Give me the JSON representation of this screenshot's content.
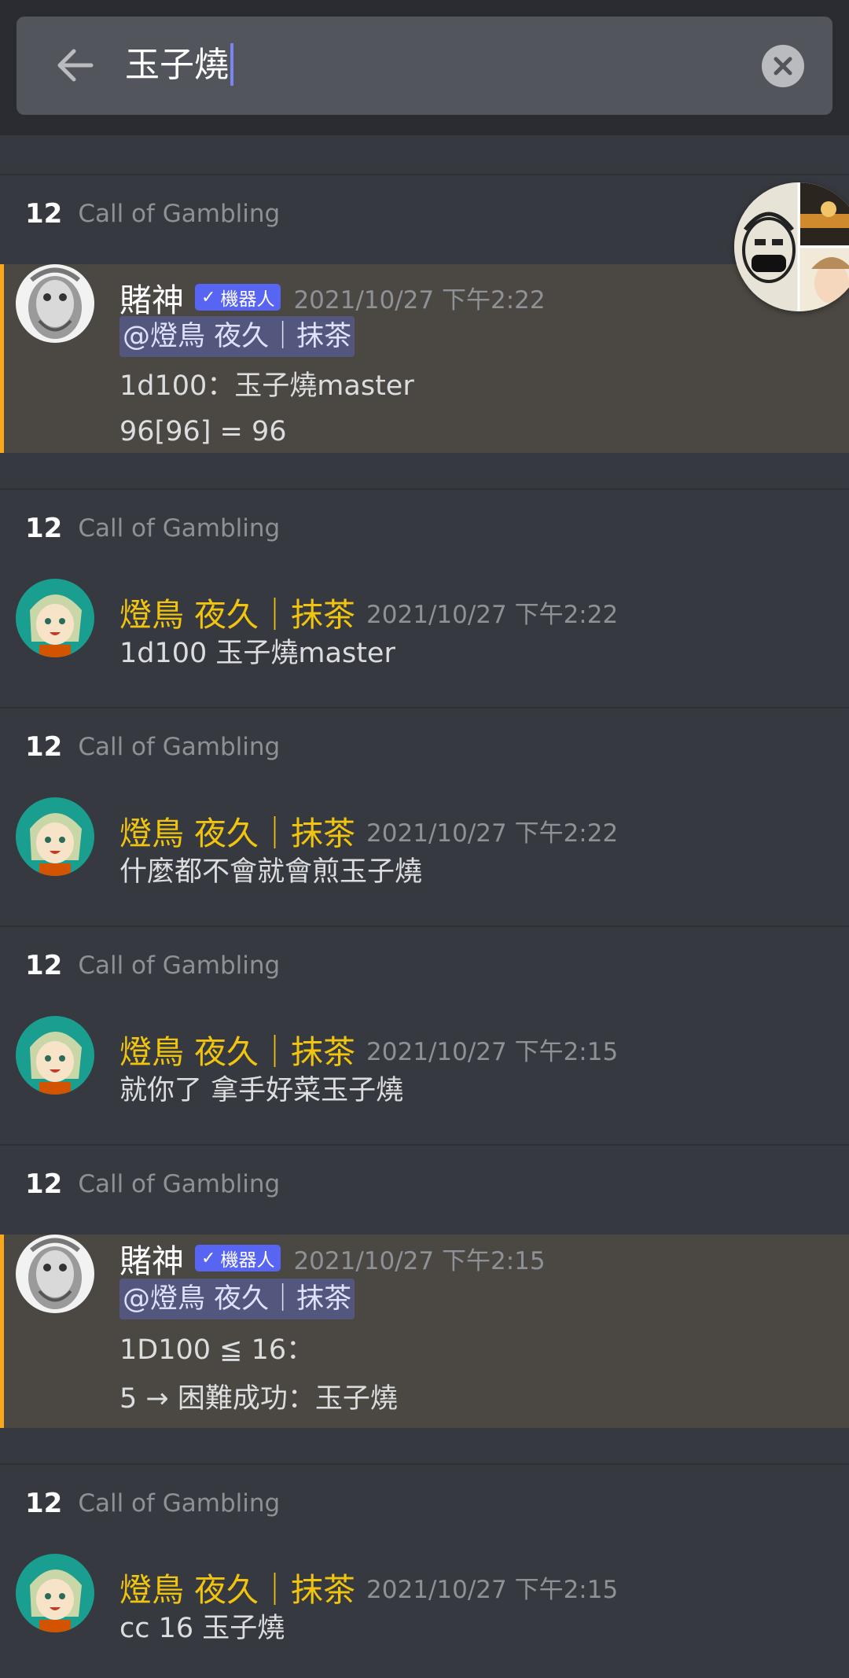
{
  "search": {
    "query": "玉子燒"
  },
  "results": [
    {
      "channel_num": "12",
      "channel_name": "Call of Gambling",
      "author": "賭神",
      "bot_badge": "機器人",
      "timestamp": "2021/10/27 下午2:22",
      "mention": "@燈鳥 夜久｜抹茶",
      "lines": [
        "1d100：玉子燒master",
        "96[96] = 96"
      ]
    },
    {
      "channel_num": "12",
      "channel_name": "Call of Gambling",
      "author": "燈鳥 夜久｜抹茶",
      "timestamp": "2021/10/27 下午2:22",
      "lines": [
        "1d100 玉子燒master"
      ]
    },
    {
      "channel_num": "12",
      "channel_name": "Call of Gambling",
      "author": "燈鳥 夜久｜抹茶",
      "timestamp": "2021/10/27 下午2:22",
      "lines": [
        "什麼都不會就會煎玉子燒"
      ]
    },
    {
      "channel_num": "12",
      "channel_name": "Call of Gambling",
      "author": "燈鳥 夜久｜抹茶",
      "timestamp": "2021/10/27 下午2:15",
      "lines": [
        "就你了 拿手好菜玉子燒"
      ]
    },
    {
      "channel_num": "12",
      "channel_name": "Call of Gambling",
      "author": "賭神",
      "bot_badge": "機器人",
      "timestamp": "2021/10/27 下午2:15",
      "mention": "@燈鳥 夜久｜抹茶",
      "lines": [
        "1D100 ≦ 16：",
        "5 → 困難成功：玉子燒"
      ]
    },
    {
      "channel_num": "12",
      "channel_name": "Call of Gambling",
      "author": "燈鳥 夜久｜抹茶",
      "timestamp": "2021/10/27 下午2:15",
      "lines": [
        "cc 16 玉子燒"
      ]
    }
  ],
  "colors": {
    "background": "#36393f",
    "topbar": "#2a2c31",
    "search_box": "#52555c",
    "user_name": "#f1c40f",
    "highlight_bg": "#4b4843",
    "highlight_bar": "#faa81a",
    "bot_tag": "#5865f2",
    "mention_bg": "#54577d"
  },
  "icons": {
    "back": "arrow-left-icon",
    "clear": "close-icon",
    "check": "check-icon"
  }
}
